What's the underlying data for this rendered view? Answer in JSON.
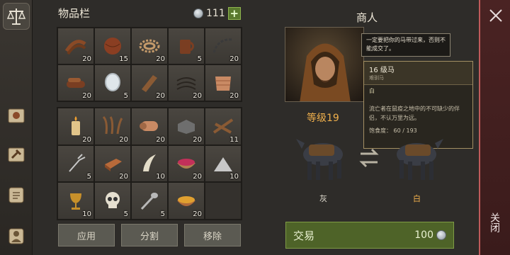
{
  "inventory": {
    "title": "物品栏",
    "currency_amount": "111",
    "add_label": "+",
    "top_slots": [
      {
        "icon": "leather-straps-icon",
        "qty": "20"
      },
      {
        "icon": "leather-ball-icon",
        "qty": "15"
      },
      {
        "icon": "rope-icon",
        "qty": "20"
      },
      {
        "icon": "leather-mug-icon",
        "qty": "5"
      },
      {
        "icon": "chain-icon",
        "qty": "20"
      },
      {
        "icon": "leather-roll-icon",
        "qty": "20"
      },
      {
        "icon": "mirror-icon",
        "qty": "5"
      },
      {
        "icon": "wood-plank-icon",
        "qty": "20"
      },
      {
        "icon": "thread-icon",
        "qty": "20"
      },
      {
        "icon": "cloth-bolt-icon",
        "qty": "20"
      }
    ],
    "bottom_slots": [
      {
        "icon": "candle-icon",
        "qty": "20"
      },
      {
        "icon": "antler-icon",
        "qty": "20"
      },
      {
        "icon": "fabric-roll-icon",
        "qty": "20"
      },
      {
        "icon": "stone-block-icon",
        "qty": "20"
      },
      {
        "icon": "sticks-icon",
        "qty": "11"
      },
      {
        "icon": "fork-icon",
        "qty": "5"
      },
      {
        "icon": "copper-ingot-icon",
        "qty": "20"
      },
      {
        "icon": "fang-icon",
        "qty": "10"
      },
      {
        "icon": "berries-bowl-icon",
        "qty": "20"
      },
      {
        "icon": "salt-pile-icon",
        "qty": "10"
      },
      {
        "icon": "goblet-icon",
        "qty": "10"
      },
      {
        "icon": "skull-icon",
        "qty": "5"
      },
      {
        "icon": "spoon-icon",
        "qty": "5"
      },
      {
        "icon": "soup-bowl-icon",
        "qty": "20"
      },
      {
        "icon": "",
        "qty": ""
      }
    ],
    "buttons": {
      "apply": "应用",
      "split": "分割",
      "remove": "移除"
    }
  },
  "merchant": {
    "title": "商人",
    "speech": "一定要把你的马带过来，否则不能成交了。",
    "tooltip": {
      "name": "16 级马",
      "subtitle": "难驯马",
      "color": "白",
      "description": "流亡者在鼠疫之地中的不可缺少的伴侣，不认万里为远。",
      "food": "饱食度： 60 / 193"
    },
    "level": "等级19",
    "horse_left_label": "灰",
    "horse_right_label": "白",
    "trade_label": "交易",
    "trade_price": "100"
  },
  "close": {
    "label": "关闭"
  },
  "colors": {
    "accent_orange": "#f0b04c",
    "trade_green": "#4e6328",
    "close_red": "#4a2323"
  }
}
